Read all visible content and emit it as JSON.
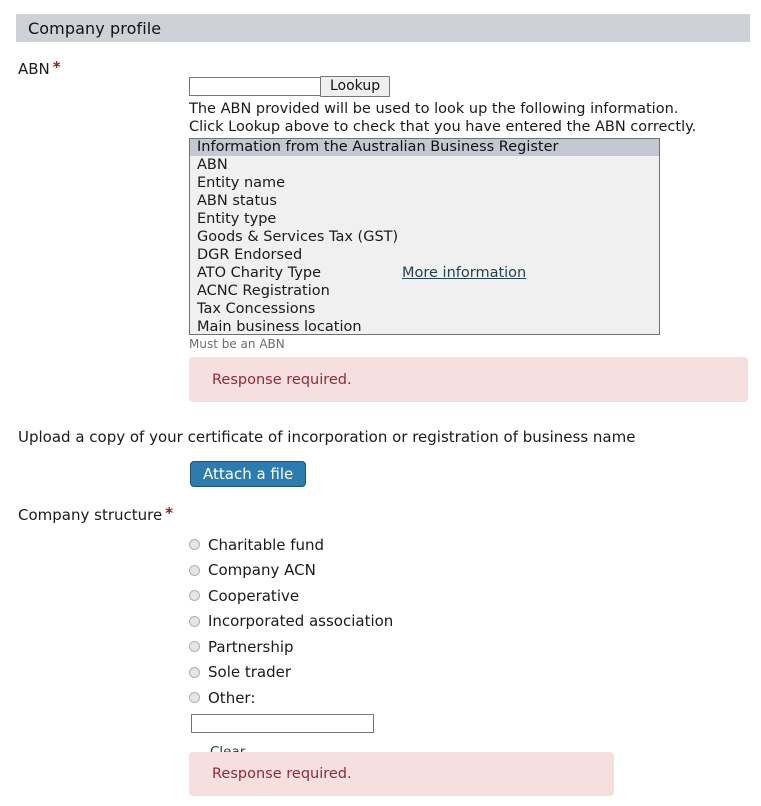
{
  "section": {
    "title": "Company profile"
  },
  "abn": {
    "label": "ABN",
    "required_marker": "*",
    "input_value": "",
    "input_placeholder": "",
    "lookup_button": "Lookup",
    "help_line_1": "The ABN provided will be used to look up the following information.",
    "help_line_2": "Click Lookup above to check that you have entered the ABN correctly.",
    "hint": "Must be an ABN",
    "error": "Response required.",
    "abr_box": {
      "header": "Information from the Australian Business Register",
      "more_information_link": "More information",
      "rows": [
        "ABN",
        "Entity name",
        "ABN status",
        "Entity type",
        "Goods & Services Tax (GST)",
        "DGR Endorsed",
        "ATO Charity Type",
        "ACNC Registration",
        "Tax Concessions",
        "Main business location"
      ]
    }
  },
  "upload": {
    "label": "Upload a copy of your certificate of incorporation or registration of business name",
    "button": "Attach a file"
  },
  "company_structure": {
    "label": "Company structure",
    "required_marker": "*",
    "options": [
      "Charitable fund",
      "Company ACN",
      "Cooperative",
      "Incorporated association",
      "Partnership",
      "Sole trader",
      "Other:"
    ],
    "other_input_value": "",
    "clear_link": "Clear",
    "error": "Response required."
  },
  "colors": {
    "header_bar": "#ced2d8",
    "required_star": "#8b1a1a",
    "error_background": "#f6dfdf",
    "error_text": "#8c2b34",
    "attach_button": "#2d7cb0",
    "abr_header": "#c4c8d2",
    "abr_body": "#f0f0f0"
  }
}
